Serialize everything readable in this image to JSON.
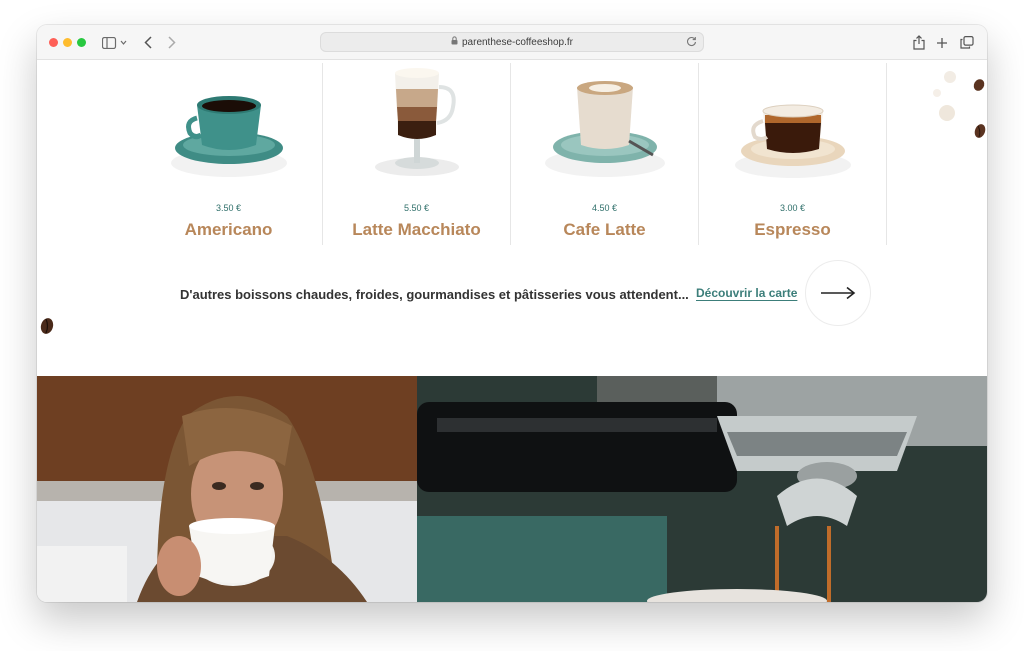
{
  "browser": {
    "url": "parenthese-coffeeshop.fr"
  },
  "products": [
    {
      "price": "3.50 €",
      "name": "Americano"
    },
    {
      "price": "5.50 €",
      "name": "Latte Macchiato"
    },
    {
      "price": "4.50 €",
      "name": "Cafe Latte"
    },
    {
      "price": "3.00 €",
      "name": "Espresso"
    }
  ],
  "promo": {
    "text": "D'autres boissons chaudes, froides, gourmandises et pâtisseries vous attendent...",
    "link_label": "Découvrir la carte"
  },
  "colors": {
    "price": "#2f6f6a",
    "product_name": "#b8875a",
    "link": "#3c7e7a"
  }
}
